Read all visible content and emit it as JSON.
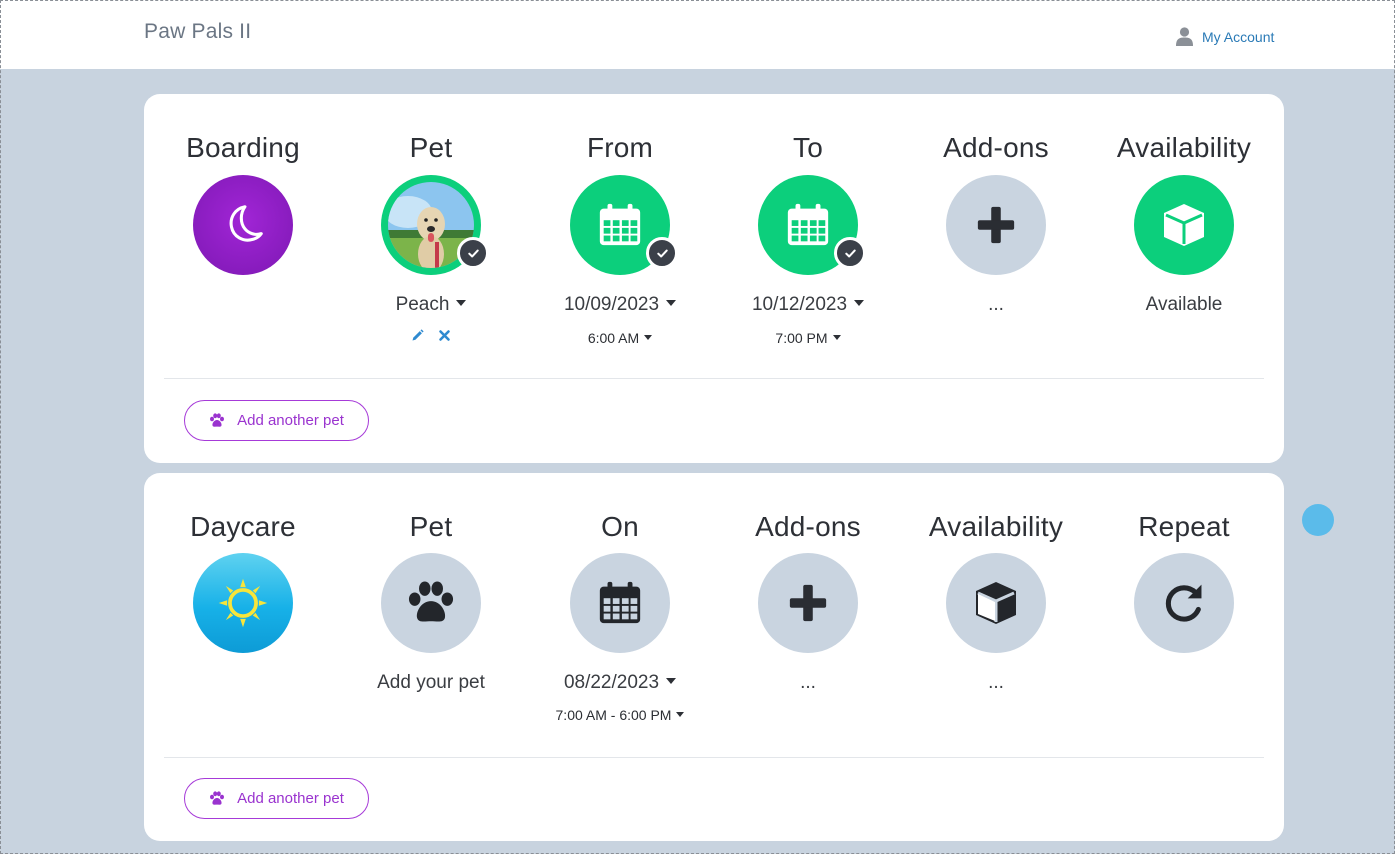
{
  "app": {
    "title": "Paw Pals II",
    "account_label": "My Account"
  },
  "boarding": {
    "service": {
      "label": "Boarding",
      "icon": "moon-icon"
    },
    "pet": {
      "label": "Pet",
      "name": "Peach"
    },
    "from": {
      "label": "From",
      "date": "10/09/2023",
      "time": "6:00 AM"
    },
    "to": {
      "label": "To",
      "date": "10/12/2023",
      "time": "7:00 PM"
    },
    "addons": {
      "label": "Add-ons",
      "value": "..."
    },
    "availability": {
      "label": "Availability",
      "value": "Available"
    },
    "add_pet_label": "Add another pet"
  },
  "daycare": {
    "service": {
      "label": "Daycare",
      "icon": "sun-icon"
    },
    "pet": {
      "label": "Pet",
      "value": "Add your pet"
    },
    "on": {
      "label": "On",
      "date": "08/22/2023",
      "time": "7:00 AM - 6:00 PM"
    },
    "addons": {
      "label": "Add-ons",
      "value": "..."
    },
    "availability": {
      "label": "Availability",
      "value": "..."
    },
    "repeat": {
      "label": "Repeat"
    },
    "add_pet_label": "Add another pet"
  },
  "colors": {
    "accent_green": "#0ccf7c",
    "accent_purple": "#9a33cf",
    "link_blue": "#2a7ab6",
    "circle_grey": "#c9d4e0",
    "background": "#c8d3df"
  }
}
